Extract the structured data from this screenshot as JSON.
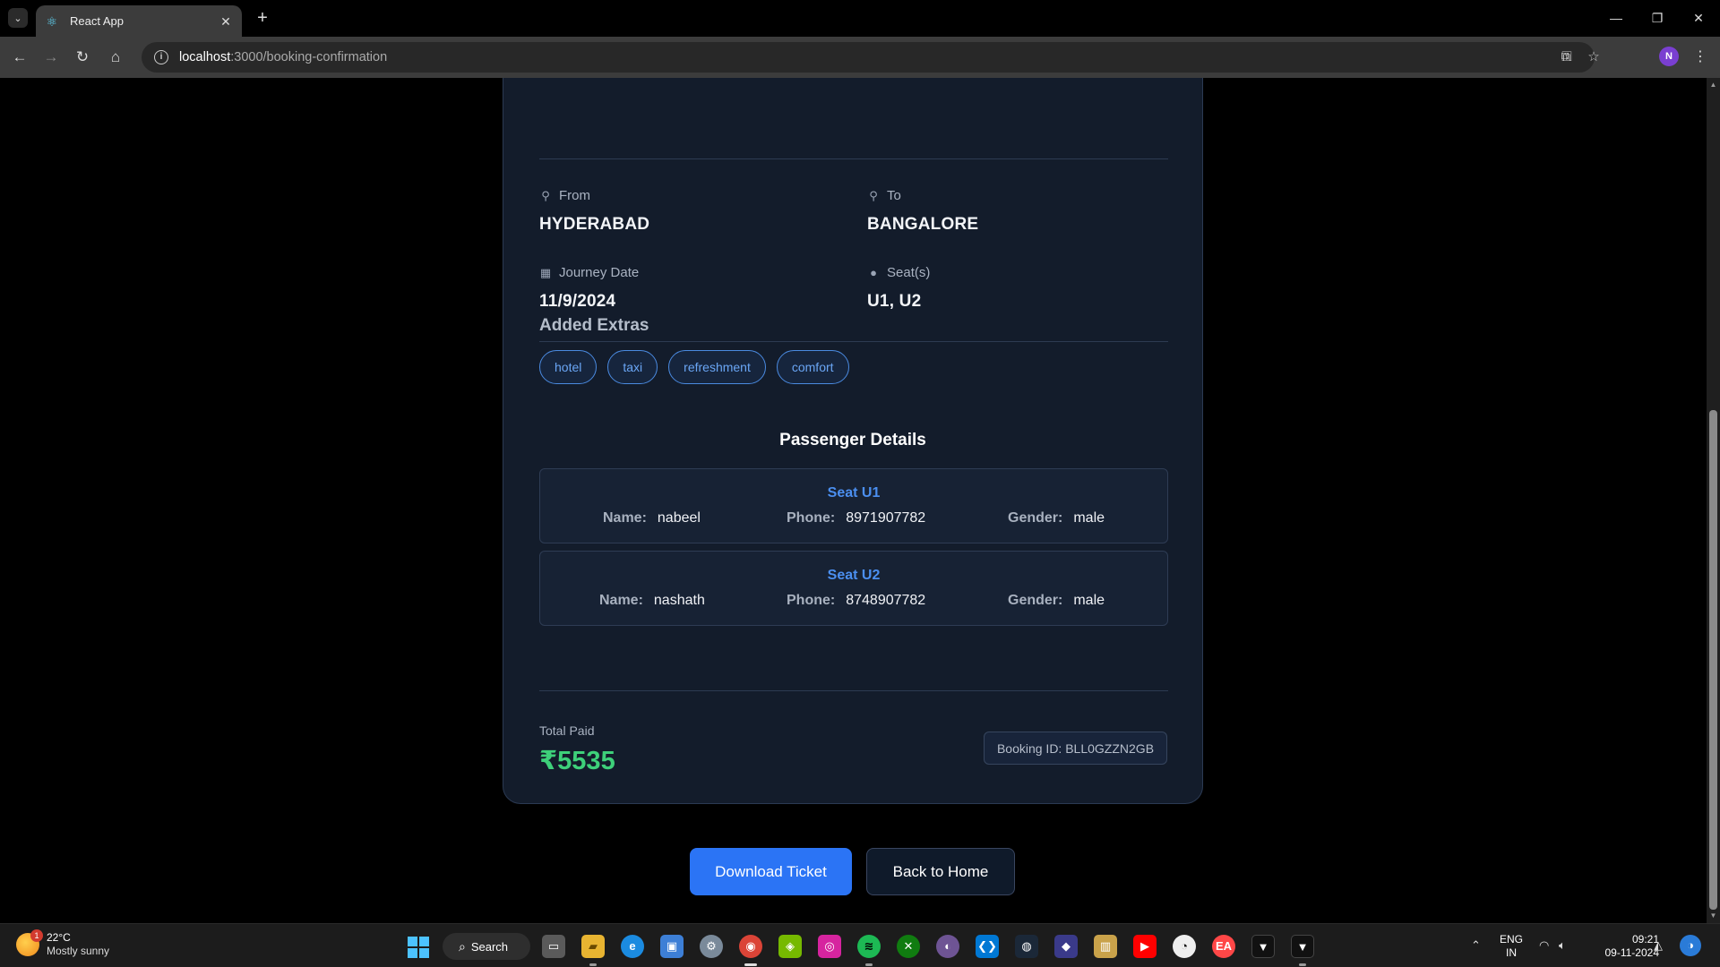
{
  "browser": {
    "tab_title": "React App",
    "url_host": "localhost",
    "url_path": ":3000/booking-confirmation",
    "profile_initial": "N"
  },
  "journey": {
    "from_label": "From",
    "from_value": "HYDERABAD",
    "to_label": "To",
    "to_value": "BANGALORE",
    "date_label": "Journey Date",
    "date_value": "11/9/2024",
    "seats_label": "Seat(s)",
    "seats_value": "U1, U2"
  },
  "extras": {
    "title": "Added Extras",
    "items": [
      "hotel",
      "taxi",
      "refreshment",
      "comfort"
    ]
  },
  "passengers": {
    "title": "Passenger Details",
    "name_key": "Name:",
    "phone_key": "Phone:",
    "gender_key": "Gender:",
    "list": [
      {
        "seat": "Seat U1",
        "name": "nabeel",
        "phone": "8971907782",
        "gender": "male"
      },
      {
        "seat": "Seat U2",
        "name": "nashath",
        "phone": "8748907782",
        "gender": "male"
      }
    ]
  },
  "payment": {
    "total_label": "Total Paid",
    "total_value": "₹5535",
    "booking_id": "Booking ID: BLL0GZZN2GB"
  },
  "actions": {
    "download": "Download Ticket",
    "home": "Back to Home"
  },
  "taskbar": {
    "temperature": "22°C",
    "weather": "Mostly sunny",
    "weather_badge": "1",
    "search": "Search",
    "lang_1": "ENG",
    "lang_2": "IN",
    "time": "09:21",
    "date": "09-11-2024"
  },
  "colors": {
    "accent_blue": "#2b74f5",
    "price_green": "#3ed07a",
    "card_bg": "#131c2b"
  }
}
